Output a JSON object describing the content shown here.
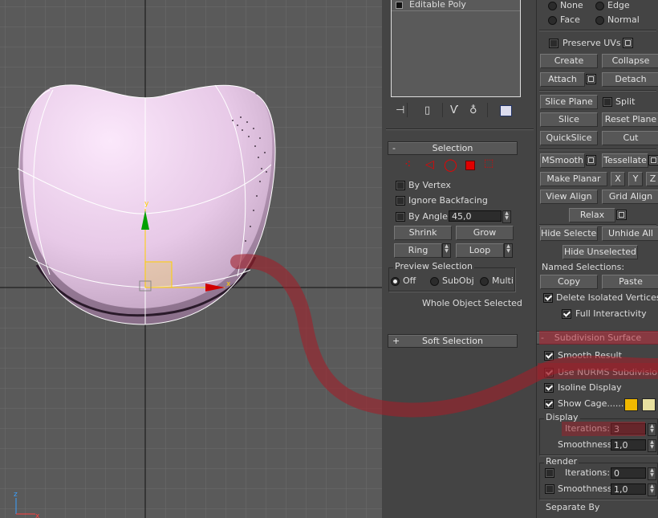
{
  "modifier_stack": {
    "item": "Editable Poly"
  },
  "selection": {
    "title": "Selection",
    "by_vertex": "By Vertex",
    "ignore_backfacing": "Ignore Backfacing",
    "by_angle": "By Angle:",
    "angle_value": "45,0",
    "shrink": "Shrink",
    "grow": "Grow",
    "ring": "Ring",
    "loop": "Loop",
    "preview_title": "Preview Selection",
    "preview_off": "Off",
    "preview_subobj": "SubObj",
    "preview_multi": "Multi",
    "status": "Whole Object Selected"
  },
  "soft_selection": {
    "title": "Soft Selection"
  },
  "edit_geometry": {
    "constraint_none": "None",
    "constraint_edge": "Edge",
    "constraint_face": "Face",
    "constraint_normal": "Normal",
    "preserve_uvs": "Preserve UVs",
    "create": "Create",
    "collapse": "Collapse",
    "attach": "Attach",
    "detach": "Detach",
    "slice_plane": "Slice Plane",
    "split": "Split",
    "slice": "Slice",
    "reset_plane": "Reset Plane",
    "quickslice": "QuickSlice",
    "cut": "Cut",
    "msmooth": "MSmooth",
    "tessellate": "Tessellate",
    "make_planar": "Make Planar",
    "x": "X",
    "y": "Y",
    "z": "Z",
    "view_align": "View Align",
    "grid_align": "Grid Align",
    "relax": "Relax",
    "hide_selected": "Hide Selected",
    "unhide_all": "Unhide All",
    "hide_unselected": "Hide Unselected",
    "named_selections": "Named Selections:",
    "copy": "Copy",
    "paste": "Paste",
    "delete_isolated": "Delete Isolated Vertices",
    "full_interactivity": "Full Interactivity"
  },
  "subdivision": {
    "title": "Subdivision Surface",
    "smooth_result": "Smooth Result",
    "use_nurms": "Use NURMS Subdivision",
    "isoline_display": "Isoline Display",
    "show_cage": "Show Cage......",
    "display_title": "Display",
    "iterations_label": "Iterations:",
    "iterations_value": "3",
    "smoothness_label": "Smoothness:",
    "smoothness_value": "1,0",
    "render_title": "Render",
    "render_iterations_value": "0",
    "render_smoothness_value": "1,0",
    "separate_by": "Separate By",
    "cage_color_1": "#f0b800",
    "cage_color_2": "#e8e0a0"
  },
  "gizmo": {
    "axis_x": "x",
    "axis_y": "y",
    "axis_z": "z",
    "triad_x": "x",
    "triad_z": "z"
  },
  "colors": {
    "viewport_bg": "#5a5a5a",
    "object_fill": "#e8cce8",
    "annotation_stroke": "#a0202a",
    "selected_red": "#e00000"
  }
}
